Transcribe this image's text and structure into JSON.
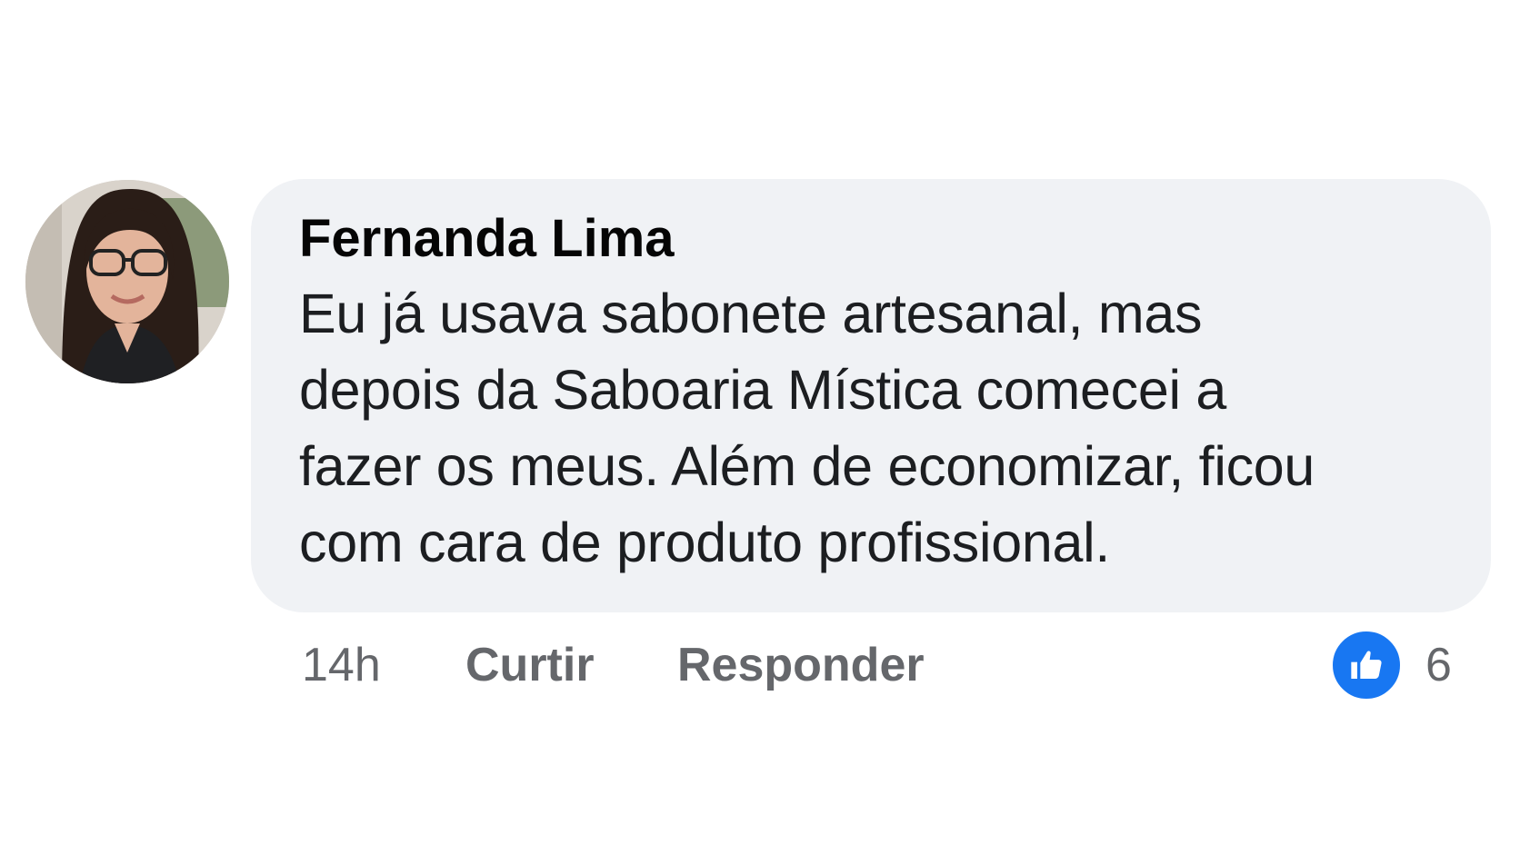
{
  "comment": {
    "author": "Fernanda Lima",
    "lines": [
      "Eu já usava sabonete artesanal, mas",
      "depois da Saboaria Mística comecei a",
      "fazer os meus. Além de economizar, ficou",
      "com cara de produto profissional."
    ],
    "timestamp": "14h",
    "like_label": "Curtir",
    "reply_label": "Responder",
    "reaction_icon": "thumbs-up-icon",
    "reaction_count": "6"
  },
  "colors": {
    "bubble_background": "#f0f2f5",
    "like_badge": "#1877f2",
    "meta_text": "#65676b"
  }
}
